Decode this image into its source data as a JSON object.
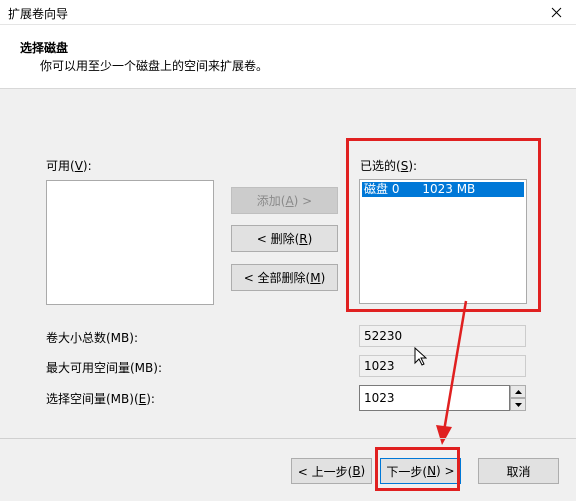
{
  "window": {
    "title": "扩展卷向导"
  },
  "header": {
    "title": "选择磁盘",
    "subtitle": "你可以用至少一个磁盘上的空间来扩展卷。"
  },
  "available": {
    "label_prefix": "可用(",
    "label_key": "V",
    "label_suffix": "):"
  },
  "selected": {
    "label_prefix": "已选的(",
    "label_key": "S",
    "label_suffix": "):",
    "items": [
      {
        "disk": "磁盘 0",
        "size": "1023 MB"
      }
    ]
  },
  "buttons": {
    "add": {
      "prefix": "添加(",
      "key": "A",
      "suffix": ") >"
    },
    "remove": {
      "prefix": "< 删除(",
      "key": "R",
      "suffix": ")"
    },
    "remove_all": {
      "prefix": "< 全部删除(",
      "key": "M",
      "suffix": ")"
    },
    "back": {
      "prefix": "< 上一步(",
      "key": "B",
      "suffix": ")"
    },
    "next": {
      "prefix": "下一步(",
      "key": "N",
      "suffix": ") >"
    },
    "cancel": "取消"
  },
  "fields": {
    "total": {
      "label": "卷大小总数(MB):",
      "value": "52230"
    },
    "max": {
      "label": "最大可用空间量(MB):",
      "value": "1023"
    },
    "select": {
      "label_prefix": "选择空间量(MB)(",
      "label_key": "E",
      "label_suffix": "):",
      "value": "1023"
    }
  },
  "colors": {
    "selection": "#0078d7",
    "annotation": "#e02020"
  }
}
